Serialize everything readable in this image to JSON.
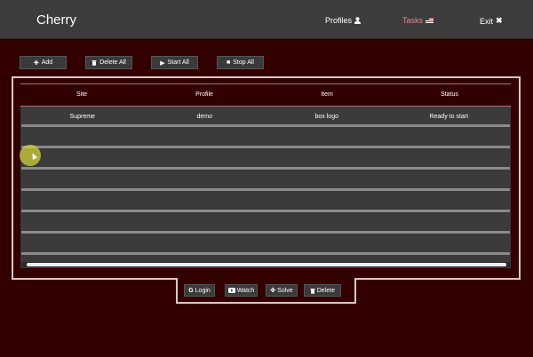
{
  "navbar": {
    "brand": "Cherry",
    "items": [
      {
        "label": "Profiles",
        "icon": "user-icon"
      },
      {
        "label": "Tasks",
        "icon": "us-flag-icon",
        "active": true
      },
      {
        "label": "Exit",
        "icon": "close-icon"
      }
    ]
  },
  "toolbar": {
    "add_label": "Add",
    "delete_all_label": "Delete All",
    "start_all_label": "Start All",
    "stop_all_label": "Stop All"
  },
  "table": {
    "headers": [
      "Site",
      "Profile",
      "Item",
      "Status"
    ],
    "rows": [
      [
        "Supreme",
        "demo",
        "box logo",
        "Ready to start"
      ]
    ]
  },
  "footer_actions": {
    "login_label": "Login",
    "watch_label": "Watch",
    "solve_label": "Solve",
    "delete_label": "Delete"
  },
  "colors": {
    "background": "#330000",
    "navbar": "#3c3c3c",
    "active_tab": "#e58b8b",
    "outline": "#d8c8c8"
  }
}
